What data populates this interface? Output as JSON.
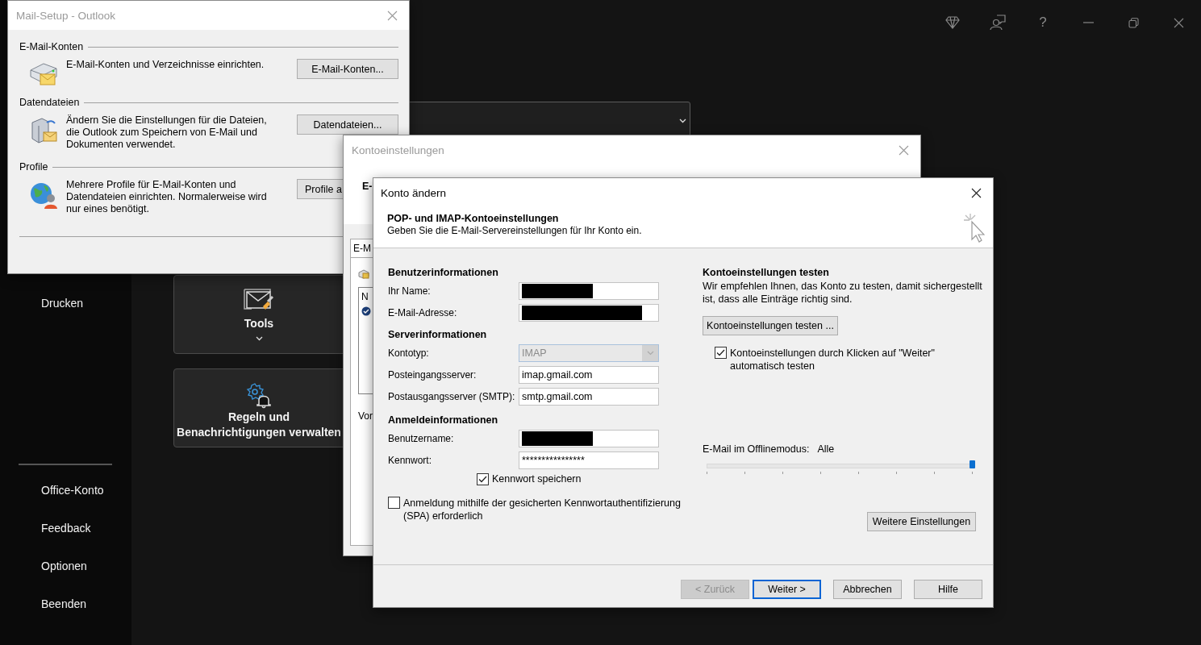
{
  "topbar": {
    "help_label": "?"
  },
  "sidebar": {
    "items_top": [
      {
        "label": "Drucken"
      }
    ],
    "items_bottom": [
      {
        "label": "Office-Konto"
      },
      {
        "label": "Feedback"
      },
      {
        "label": "Optionen"
      },
      {
        "label": "Beenden"
      }
    ]
  },
  "tiles": [
    {
      "kind": "tools",
      "lines": [
        "Tools"
      ],
      "has_menu": true
    },
    {
      "kind": "rules",
      "lines": [
        "Regeln und",
        "Benachrichtigungen verwalten"
      ],
      "has_menu": false
    }
  ],
  "mail_setup_window": {
    "title": "Mail-Setup - Outlook",
    "sections": [
      {
        "kind": "accounts",
        "heading": "E-Mail-Konten",
        "lines": [
          "E-Mail-Konten und Verzeichnisse einrichten."
        ],
        "button": "E-Mail-Konten..."
      },
      {
        "kind": "datafiles",
        "heading": "Datendateien",
        "lines": [
          "Ändern Sie die Einstellungen für die Dateien,",
          "die Outlook zum Speichern von E-Mail und",
          "Dokumenten verwendet."
        ],
        "button": "Datendateien..."
      },
      {
        "kind": "profiles",
        "heading": "Profile",
        "lines": [
          "Mehrere Profile für E-Mail-Konten und",
          "Datendateien einrichten. Normalerweise wird",
          "nur eines benötigt."
        ],
        "button": "Profile a"
      }
    ]
  },
  "account_settings_window": {
    "title": "Kontoeinstellungen",
    "heading": "E-",
    "tab": "E-M",
    "list_header": "N",
    "footer_text": "Vor"
  },
  "change_account_dialog": {
    "title": "Konto ändern",
    "header_title": "POP- und IMAP-Kontoeinstellungen",
    "header_subtitle": "Geben Sie die E-Mail-Servereinstellungen für Ihr Konto ein.",
    "sections": [
      {
        "heading": "Benutzerinformationen",
        "fields": [
          {
            "label": "Ihr Name:",
            "kind": "redacted"
          },
          {
            "label": "E-Mail-Adresse:",
            "kind": "redacted"
          }
        ]
      },
      {
        "heading": "Serverinformationen",
        "fields": [
          {
            "label": "Kontotyp:",
            "kind": "dropdown",
            "value": "IMAP",
            "disabled": true
          },
          {
            "label": "Posteingangsserver:",
            "kind": "text",
            "value": "imap.gmail.com"
          },
          {
            "label": "Postausgangsserver (SMTP):",
            "kind": "text",
            "value": "smtp.gmail.com"
          }
        ]
      },
      {
        "heading": "Anmeldeinformationen",
        "fields": [
          {
            "label": "Benutzername:",
            "kind": "redacted"
          },
          {
            "label": "Kennwort:",
            "kind": "text",
            "value": "****************"
          }
        ]
      }
    ],
    "save_password": {
      "label": "Kennwort speichern",
      "checked": true
    },
    "spa": {
      "lines": [
        "Anmeldung mithilfe der gesicherten Kennwortauthentifizierung",
        "(SPA) erforderlich"
      ],
      "checked": false
    },
    "test": {
      "heading": "Kontoeinstellungen testen",
      "lines": [
        "Wir empfehlen Ihnen, das Konto zu testen, damit sichergestellt",
        "ist, dass alle Einträge richtig sind."
      ],
      "button": "Kontoeinstellungen testen ...",
      "auto_test": {
        "lines": [
          "Kontoeinstellungen durch Klicken auf \"Weiter\"",
          "automatisch testen"
        ],
        "checked": true
      }
    },
    "offline": {
      "label": "E-Mail im Offlinemodus:",
      "value": "Alle",
      "level": 1
    },
    "more_button": "Weitere Einstellungen",
    "buttons": [
      {
        "label": "< Zurück",
        "disabled": true,
        "default": false
      },
      {
        "label": "Weiter >",
        "disabled": false,
        "default": true
      },
      {
        "label": "Abbrechen",
        "disabled": false,
        "default": false
      },
      {
        "label": "Hilfe",
        "disabled": false,
        "default": false
      }
    ]
  }
}
